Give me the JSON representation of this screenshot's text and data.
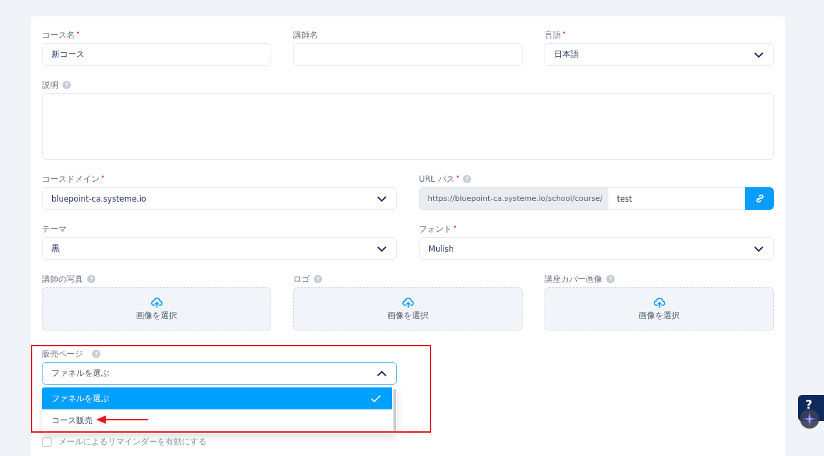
{
  "rows": [
    {
      "fields": [
        {
          "kind": "text",
          "label": "コース名",
          "required": true,
          "help": false,
          "value": "新コース"
        },
        {
          "kind": "text",
          "label": "講師名",
          "required": false,
          "help": false
        },
        {
          "kind": "select",
          "label": "言語",
          "required": true,
          "help": false,
          "value": "日本語"
        }
      ]
    },
    {
      "fields": [
        {
          "kind": "textarea",
          "label": "説明",
          "required": false,
          "help": true
        }
      ]
    },
    {
      "fields": [
        {
          "kind": "select",
          "label": "コースドメイン",
          "required": true,
          "help": false,
          "value": "bluepoint-ca.systeme.io"
        },
        {
          "kind": "url",
          "label": "URL パス",
          "required": true,
          "help": true,
          "prefix": "https://bluepoint-ca.systeme.io/school/course/",
          "value": "test"
        }
      ]
    },
    {
      "fields": [
        {
          "kind": "select",
          "label": "テーマ",
          "required": false,
          "help": false,
          "value": "黒"
        },
        {
          "kind": "select",
          "label": "フォント",
          "required": true,
          "help": false,
          "value": "Mulish"
        }
      ]
    },
    {
      "fields": [
        {
          "kind": "upload",
          "label": "講師の写真",
          "required": false,
          "help": true,
          "button": "画像を選択"
        },
        {
          "kind": "upload",
          "label": "ロゴ",
          "required": false,
          "help": true,
          "button": "画像を選択"
        },
        {
          "kind": "upload",
          "label": "講座カバー画像",
          "required": false,
          "help": true,
          "button": "画像を選択"
        }
      ]
    }
  ],
  "sales_page": {
    "label": "販売ページ",
    "help": true,
    "value": "ファネルを選ぶ",
    "expanded": true,
    "options": [
      {
        "label": "ファネルを選ぶ",
        "selected": true
      },
      {
        "label": "コース販売",
        "selected": false
      }
    ]
  },
  "reminder": {
    "label": "メールによるリマインダーを有効にする",
    "checked": false
  },
  "help_widget": {
    "label": "?"
  }
}
